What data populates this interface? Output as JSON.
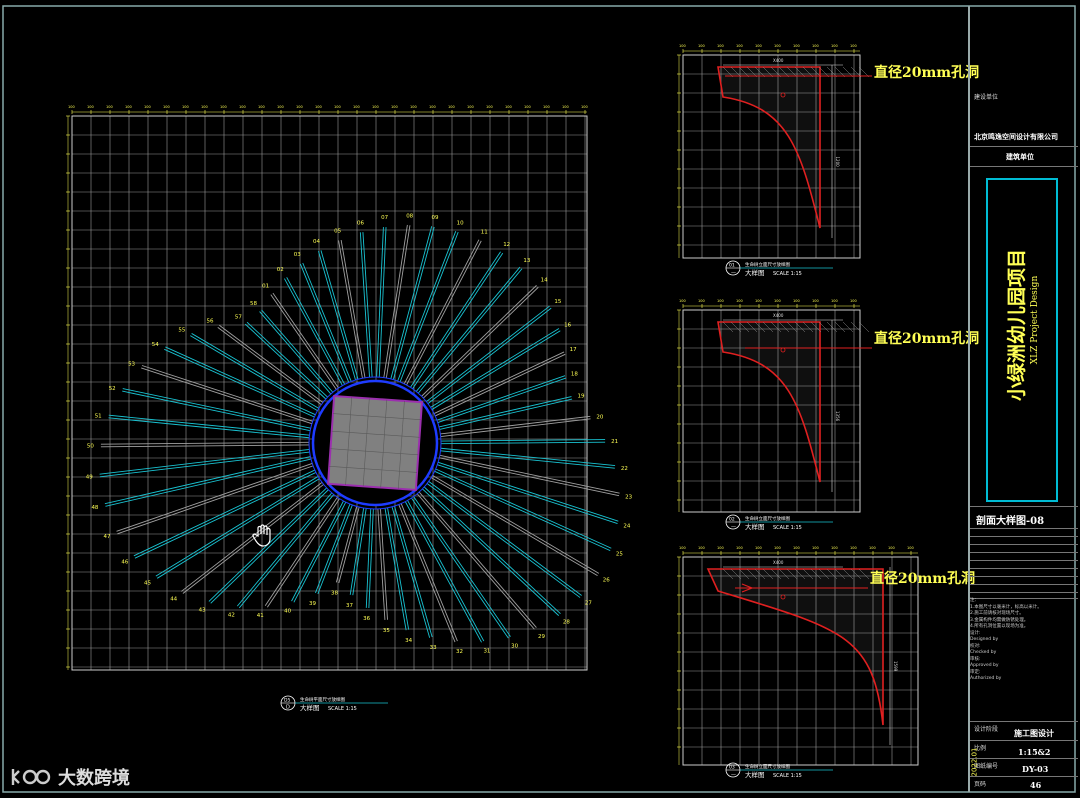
{
  "drawing": {
    "project_title": "小绿洲幼儿园项目",
    "project_subtitle": "XLZ Project Design",
    "company_label": "建设单位",
    "company": "北京鸣逸空间设计有限公司",
    "design_unit": "建筑单位",
    "sheet_title": "剖面大样图-08",
    "stage_label": "设计阶段",
    "stage": "施工图设计",
    "scale_label": "比例",
    "scale": "1:15&2",
    "drawing_no_label": "图纸编号",
    "drawing_no": "DY-03",
    "page_label": "页码",
    "page": "46",
    "date_label": "2022.01",
    "notes": [
      "注：",
      "1.本图尺寸以毫米计，标高以米计。",
      "2.施工前请核对现场尺寸。",
      "3.金属构件均需做防锈处理。",
      "4.所有孔洞位置以现场为准。",
      "设计:",
      "Designed by",
      "校对:",
      "Checked by",
      "审核:",
      "Approved by",
      "审定:",
      "Authorized by"
    ]
  },
  "callouts": {
    "hole_1": "直径20mm孔洞",
    "hole_2": "直径20mm孔洞",
    "hole_3": "直径20mm孔洞"
  },
  "views": {
    "main": {
      "id": "D5",
      "sub": "D",
      "title": "大样图",
      "desc": "生命树平面尺寸放样图",
      "scale": "SCALE 1:15"
    },
    "detail_1": {
      "id": "01",
      "sub": "—",
      "title": "大样图",
      "desc": "生命树立面尺寸放样图",
      "scale": "SCALE 1:15"
    },
    "detail_2": {
      "id": "02",
      "sub": "—",
      "title": "大样图",
      "desc": "生命树立面尺寸放样图",
      "scale": "SCALE 1:15"
    },
    "detail_3": {
      "id": "03",
      "sub": "—",
      "title": "大样图",
      "desc": "生命树立面尺寸放样图",
      "scale": "SCALE 1:15"
    }
  },
  "dims": {
    "d1_width": "X400",
    "d1_height": "1200",
    "d2_width": "X400",
    "d2_height": "1356",
    "d3_width": "X400",
    "d3_height": "1599"
  },
  "watermark": "大数跨境",
  "colors": {
    "cyan": "#19c3d2",
    "yellow": "#ffff55",
    "red": "#e02020",
    "blue": "#1e3cff",
    "grid": "#9a9a9a",
    "gray": "#a0a0a0"
  }
}
